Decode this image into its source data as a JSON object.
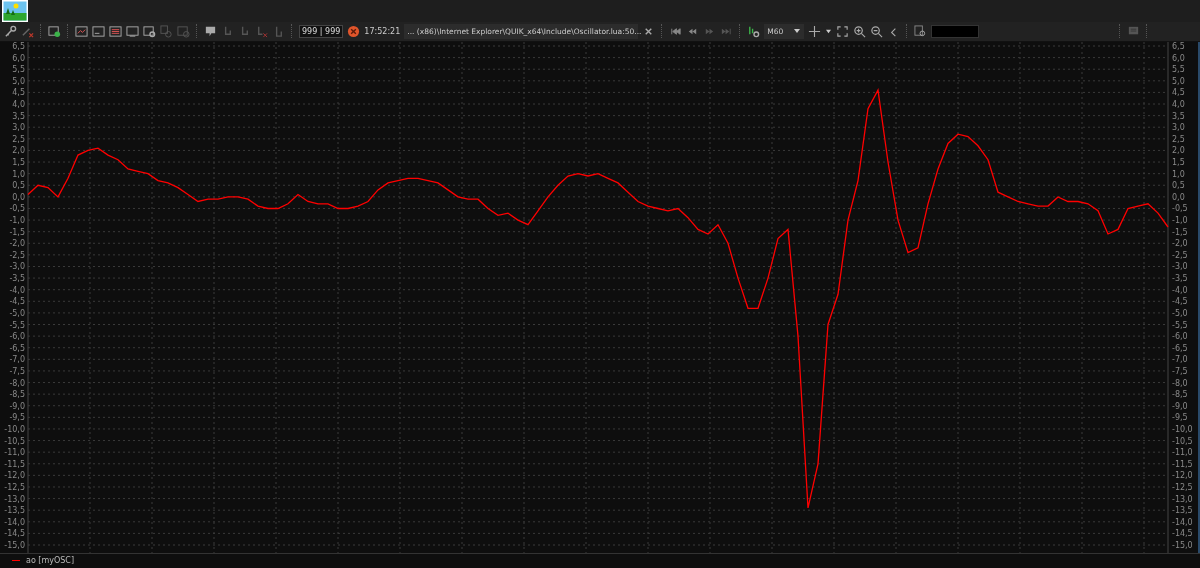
{
  "toolbar": {
    "counter": "999 | 999",
    "time": "17:52:21",
    "script_path": "... (x86)\\Internet Explorer\\QUIK_x64\\Include\\Oscillator.lua:50...",
    "interval": "M60"
  },
  "chart": {
    "chart_data": {
      "type": "line",
      "grid": true,
      "ylim": [
        -15,
        6.5
      ],
      "yticks": [
        {
          "value": 6.5,
          "label": "6,5"
        },
        {
          "value": 6,
          "label": "6,0"
        },
        {
          "value": 5.5,
          "label": "5,5"
        },
        {
          "value": 5,
          "label": "5,0"
        },
        {
          "value": 4.5,
          "label": "4,5"
        },
        {
          "value": 4,
          "label": "4,0"
        },
        {
          "value": 3.5,
          "label": "3,5"
        },
        {
          "value": 3,
          "label": "3,0"
        },
        {
          "value": 2.5,
          "label": "2,5"
        },
        {
          "value": 2,
          "label": "2,0"
        },
        {
          "value": 1.5,
          "label": "1,5"
        },
        {
          "value": 1,
          "label": "1,0"
        },
        {
          "value": 0.5,
          "label": "0,5"
        },
        {
          "value": 0,
          "label": "0,0"
        },
        {
          "value": -0.5,
          "label": "-0,5"
        },
        {
          "value": -1,
          "label": "-1,0"
        },
        {
          "value": -1.5,
          "label": "-1,5"
        },
        {
          "value": -2,
          "label": "-2,0"
        },
        {
          "value": -2.5,
          "label": "-2,5"
        },
        {
          "value": -3,
          "label": "-3,0"
        },
        {
          "value": -3.5,
          "label": "-3,5"
        },
        {
          "value": -4,
          "label": "-4,0"
        },
        {
          "value": -4.5,
          "label": "-4,5"
        },
        {
          "value": -5,
          "label": "-5,0"
        },
        {
          "value": -5.5,
          "label": "-5,5"
        },
        {
          "value": -6,
          "label": "-6,0"
        },
        {
          "value": -6.5,
          "label": "-6,5"
        },
        {
          "value": -7,
          "label": "-7,0"
        },
        {
          "value": -7.5,
          "label": "-7,5"
        },
        {
          "value": -8,
          "label": "-8,0"
        },
        {
          "value": -8.5,
          "label": "-8,5"
        },
        {
          "value": -9,
          "label": "-9,0"
        },
        {
          "value": -9.5,
          "label": "-9,5"
        },
        {
          "value": -10,
          "label": "-10,0"
        },
        {
          "value": -10.5,
          "label": "-10,5"
        },
        {
          "value": -11,
          "label": "-11,0"
        },
        {
          "value": -11.5,
          "label": "-11,5"
        },
        {
          "value": -12,
          "label": "-12,0"
        },
        {
          "value": -12.5,
          "label": "-12,5"
        },
        {
          "value": -13,
          "label": "-13,0"
        },
        {
          "value": -13.5,
          "label": "-13,5"
        },
        {
          "value": -14,
          "label": "-14,0"
        },
        {
          "value": -14.5,
          "label": "-14,5"
        },
        {
          "value": -15,
          "label": "-15,0"
        }
      ],
      "categories": [
        null,
        null,
        null,
        null,
        null,
        null,
        null,
        null,
        null,
        null,
        null,
        null,
        null,
        null,
        null,
        null,
        null,
        null,
        null,
        null,
        null,
        null,
        null,
        null,
        null,
        null,
        null,
        null,
        null,
        null,
        null,
        null,
        null,
        null,
        null,
        null,
        null,
        null,
        null,
        null,
        null,
        null,
        null,
        null,
        null,
        null,
        null,
        null,
        null,
        null,
        null,
        null,
        null,
        null,
        null,
        null,
        null,
        null,
        null,
        null,
        null,
        null,
        null,
        null,
        null,
        null,
        null,
        null,
        null,
        null,
        null,
        null,
        null,
        null,
        null,
        null,
        null,
        null,
        null,
        null,
        null,
        null,
        null,
        null,
        null,
        null,
        null,
        null,
        null,
        null,
        null,
        null,
        null,
        null,
        null,
        null,
        null,
        null,
        null,
        null,
        null,
        null,
        null,
        null,
        null,
        null,
        null,
        null,
        null,
        null,
        null,
        null,
        null,
        null,
        null
      ],
      "series": [
        {
          "name": "ao [myOSC]",
          "color": "#ff0000",
          "values": [
            0.1,
            0.5,
            0.4,
            0.0,
            0.8,
            1.8,
            2.0,
            2.1,
            1.8,
            1.6,
            1.2,
            1.1,
            1.0,
            0.7,
            0.6,
            0.4,
            0.1,
            -0.2,
            -0.1,
            -0.1,
            0.0,
            0.0,
            -0.1,
            -0.4,
            -0.5,
            -0.5,
            -0.3,
            0.1,
            -0.2,
            -0.3,
            -0.3,
            -0.5,
            -0.5,
            -0.4,
            -0.2,
            0.3,
            0.6,
            0.7,
            0.8,
            0.8,
            0.7,
            0.6,
            0.3,
            0.0,
            -0.1,
            -0.1,
            -0.5,
            -0.8,
            -0.7,
            -1.0,
            -1.2,
            -0.6,
            0.0,
            0.5,
            0.9,
            1.0,
            0.9,
            1.0,
            0.8,
            0.6,
            0.2,
            -0.2,
            -0.4,
            -0.5,
            -0.6,
            -0.5,
            -0.9,
            -1.4,
            -1.6,
            -1.2,
            -2.0,
            -3.5,
            -4.8,
            -4.8,
            -3.5,
            -1.8,
            -1.4,
            -6.0,
            -13.4,
            -11.5,
            -5.5,
            -4.2,
            -1.0,
            0.7,
            3.8,
            4.6,
            1.5,
            -1.0,
            -2.4,
            -2.2,
            -0.3,
            1.2,
            2.3,
            2.7,
            2.6,
            2.2,
            1.6,
            0.2,
            0.0,
            -0.2,
            -0.3,
            -0.4,
            -0.4,
            0.0,
            -0.2,
            -0.2,
            -0.3,
            -0.6,
            -1.6,
            -1.4,
            -0.5,
            -0.4,
            -0.3,
            -0.7,
            -1.3
          ]
        }
      ]
    }
  }
}
